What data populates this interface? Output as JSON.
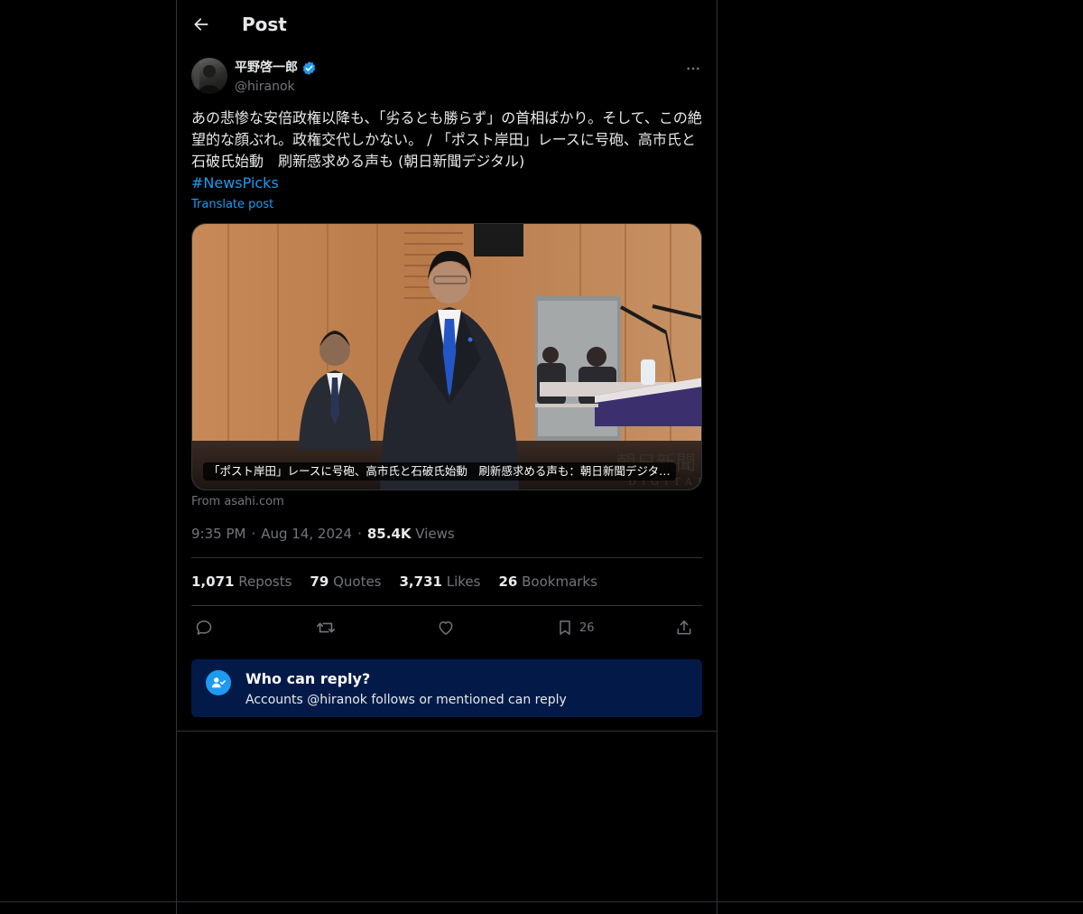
{
  "header": {
    "title": "Post"
  },
  "author": {
    "display_name": "平野啓一郎",
    "handle": "@hiranok"
  },
  "post": {
    "text": "あの悲惨な安倍政権以降も、「劣るとも勝らず」の首相ばかり。そして、この絶望的な顔ぶれ。政権交代しかない。 / 「ポスト岸田」レースに号砲、高市氏と石破氏始動　刷新感求める声も (朝日新聞デジタル)",
    "hashtag": "#NewsPicks",
    "translate_label": "Translate post"
  },
  "card": {
    "caption": "「ポスト岸田」レースに号砲、高市氏と石破氏始動　刷新感求める声も：朝日新聞デジタ…",
    "watermark_main": "朝日新聞",
    "watermark_sub": "DIGITAL",
    "source": "From asahi.com"
  },
  "meta": {
    "time": "9:35 PM",
    "date": "Aug 14, 2024",
    "views_count": "85.4K",
    "views_label": "Views"
  },
  "stats": {
    "reposts_count": "1,071",
    "reposts_label": "Reposts",
    "quotes_count": "79",
    "quotes_label": "Quotes",
    "likes_count": "3,731",
    "likes_label": "Likes",
    "bookmarks_count": "26",
    "bookmarks_label": "Bookmarks"
  },
  "actions": {
    "bookmark_count": "26",
    "icons": [
      "reply-icon",
      "repost-icon",
      "like-icon",
      "bookmark-icon",
      "share-icon"
    ]
  },
  "reply_restriction": {
    "title": "Who can reply?",
    "description": "Accounts @hiranok follows or mentioned can reply"
  },
  "colors": {
    "background": "#000000",
    "text": "#e7e9ea",
    "secondary": "#71767b",
    "accent": "#1d9bf0",
    "border": "#2f3336",
    "reply_box": "#031a49"
  }
}
